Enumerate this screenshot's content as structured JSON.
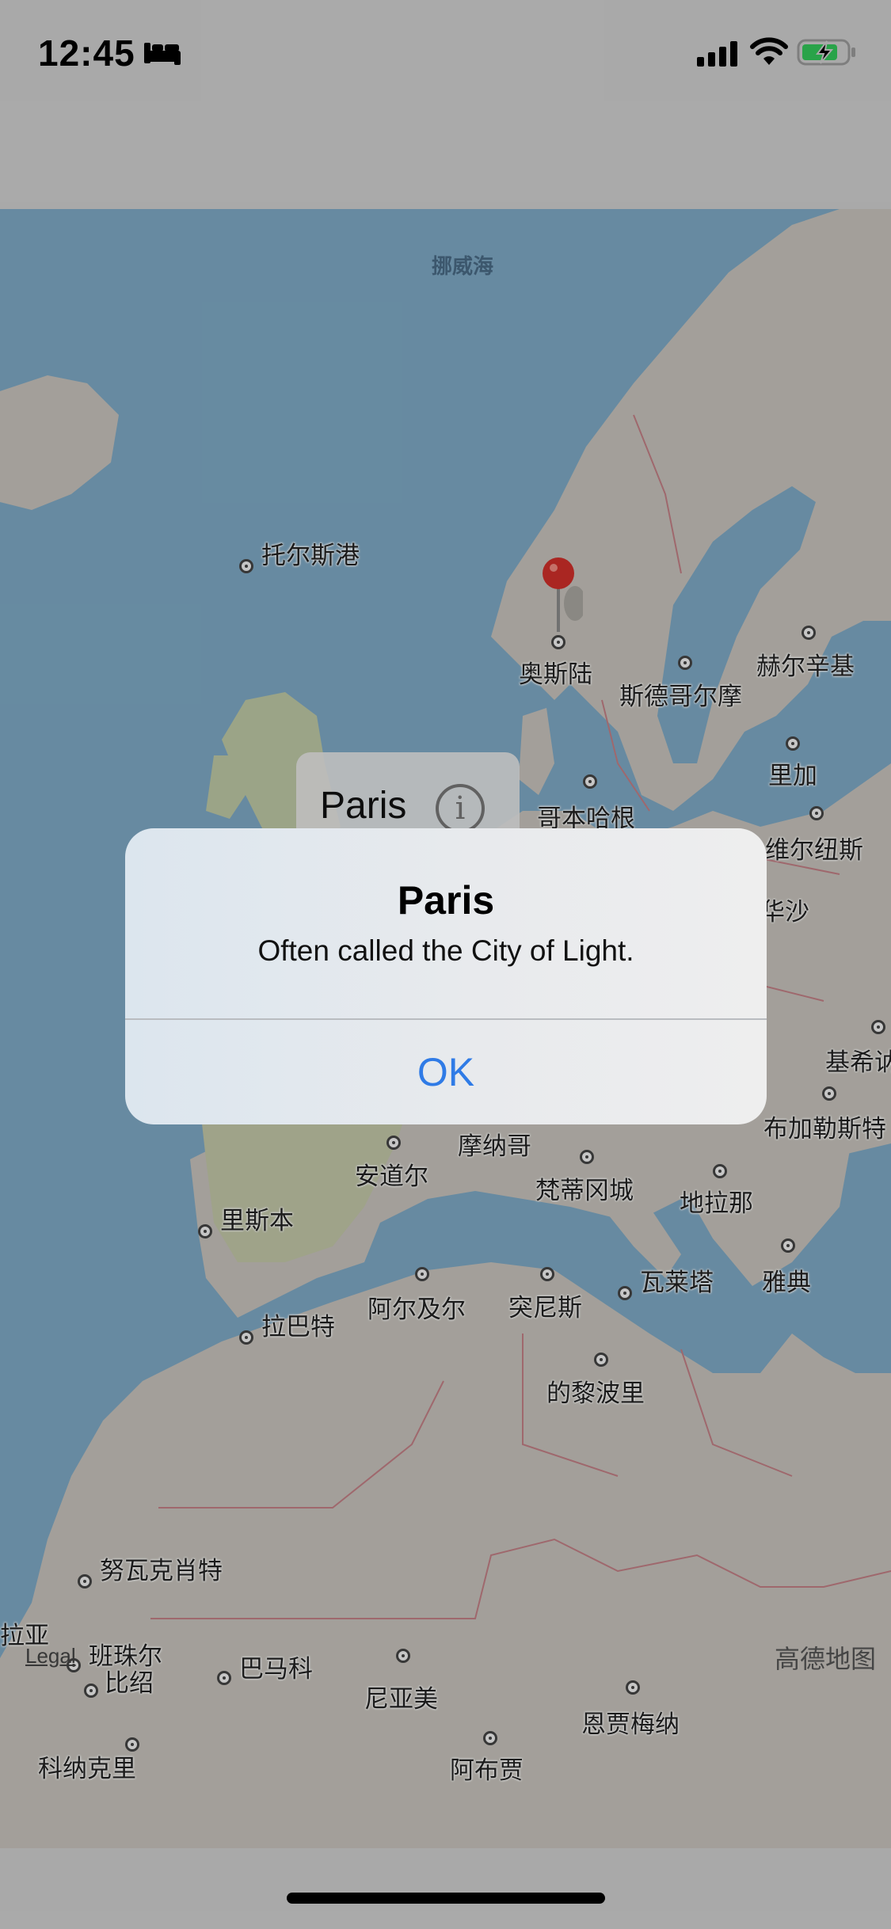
{
  "status_bar": {
    "time": "12:45"
  },
  "map": {
    "sea_labels": [
      "挪威海"
    ],
    "cities": [
      {
        "name": "托尔斯港"
      },
      {
        "name": "奥斯陆"
      },
      {
        "name": "斯德哥尔摩"
      },
      {
        "name": "赫尔辛基"
      },
      {
        "name": "里加"
      },
      {
        "name": "哥本哈根"
      },
      {
        "name": "维尔纽斯"
      },
      {
        "name": "华沙"
      },
      {
        "name": "基希讷"
      },
      {
        "name": "布加勒斯特"
      },
      {
        "name": "摩纳哥"
      },
      {
        "name": "安道尔"
      },
      {
        "name": "梵蒂冈城"
      },
      {
        "name": "地拉那"
      },
      {
        "name": "里斯本"
      },
      {
        "name": "瓦莱塔"
      },
      {
        "name": "雅典"
      },
      {
        "name": "阿尔及尔"
      },
      {
        "name": "突尼斯"
      },
      {
        "name": "拉巴特"
      },
      {
        "name": "的黎波里"
      },
      {
        "name": "努瓦克肖特"
      },
      {
        "name": "拉亚"
      },
      {
        "name": "班珠尔"
      },
      {
        "name": "比绍"
      },
      {
        "name": "巴马科"
      },
      {
        "name": "尼亚美"
      },
      {
        "name": "恩贾梅纳"
      },
      {
        "name": "科纳克里"
      },
      {
        "name": "阿布贾"
      }
    ],
    "legal_label": "Legal",
    "attribution": "高德地图",
    "callout": {
      "title": "Paris"
    }
  },
  "alert": {
    "title": "Paris",
    "message": "Often called the City of Light.",
    "ok_label": "OK"
  }
}
